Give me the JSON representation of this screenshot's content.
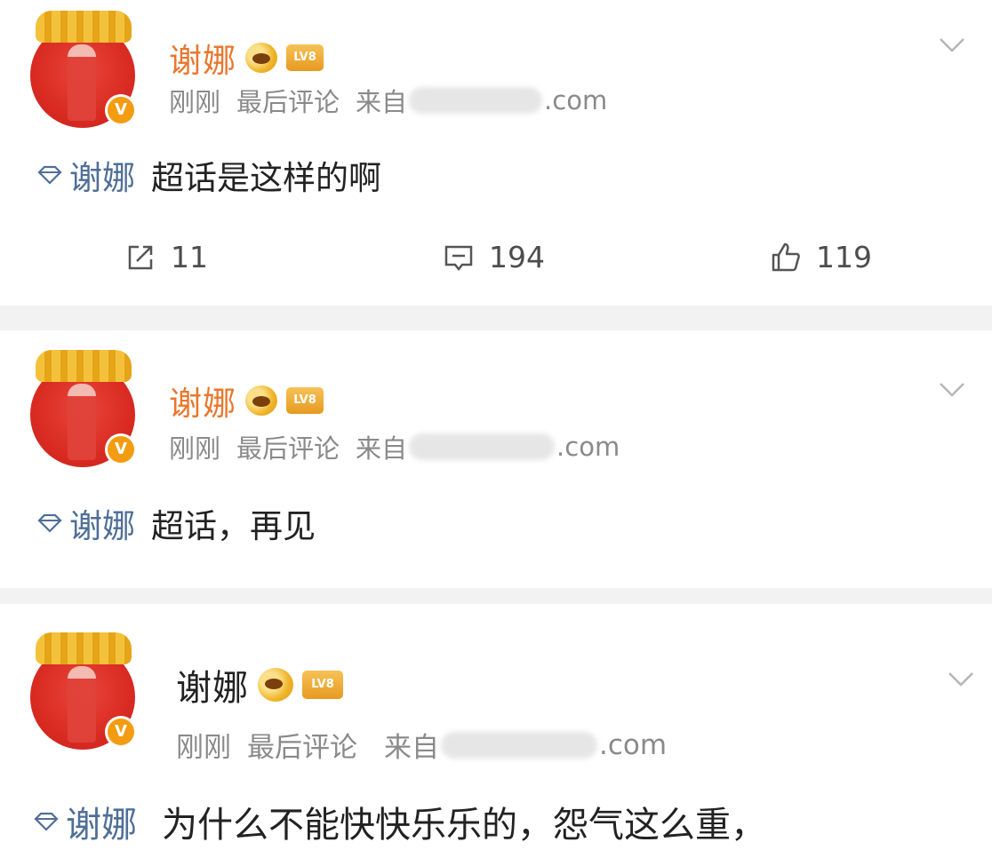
{
  "posts": [
    {
      "author": "谢娜",
      "level": "LV8",
      "time": "刚刚",
      "last_comment": "最后评论",
      "from_label": "来自",
      "source_suffix": ".com",
      "topic": "谢娜",
      "text": "超话是这样的啊",
      "actions": {
        "repost": "11",
        "comment": "194",
        "like": "119"
      }
    },
    {
      "author": "谢娜",
      "level": "LV8",
      "time": "刚刚",
      "last_comment": "最后评论",
      "from_label": "来自",
      "source_suffix": ".com",
      "topic": "谢娜",
      "text": "超话，再见"
    },
    {
      "author": "谢娜",
      "level": "LV8",
      "time": "刚刚",
      "last_comment": "最后评论",
      "from_label": "来自",
      "source_suffix": ".com",
      "topic": "谢娜",
      "text": "为什么不能快快乐乐的，怨气这么重，"
    }
  ],
  "colors": {
    "username": "#e8772e",
    "topic": "#4f6f97",
    "meta": "#8a8a8a"
  },
  "icons": {
    "verified": "verified-v-badge",
    "crown": "crown-icon",
    "topic": "diamond-topic-icon",
    "menu": "chevron-down-icon",
    "repost": "repost-icon",
    "comment": "comment-icon",
    "like": "thumbs-up-icon"
  }
}
